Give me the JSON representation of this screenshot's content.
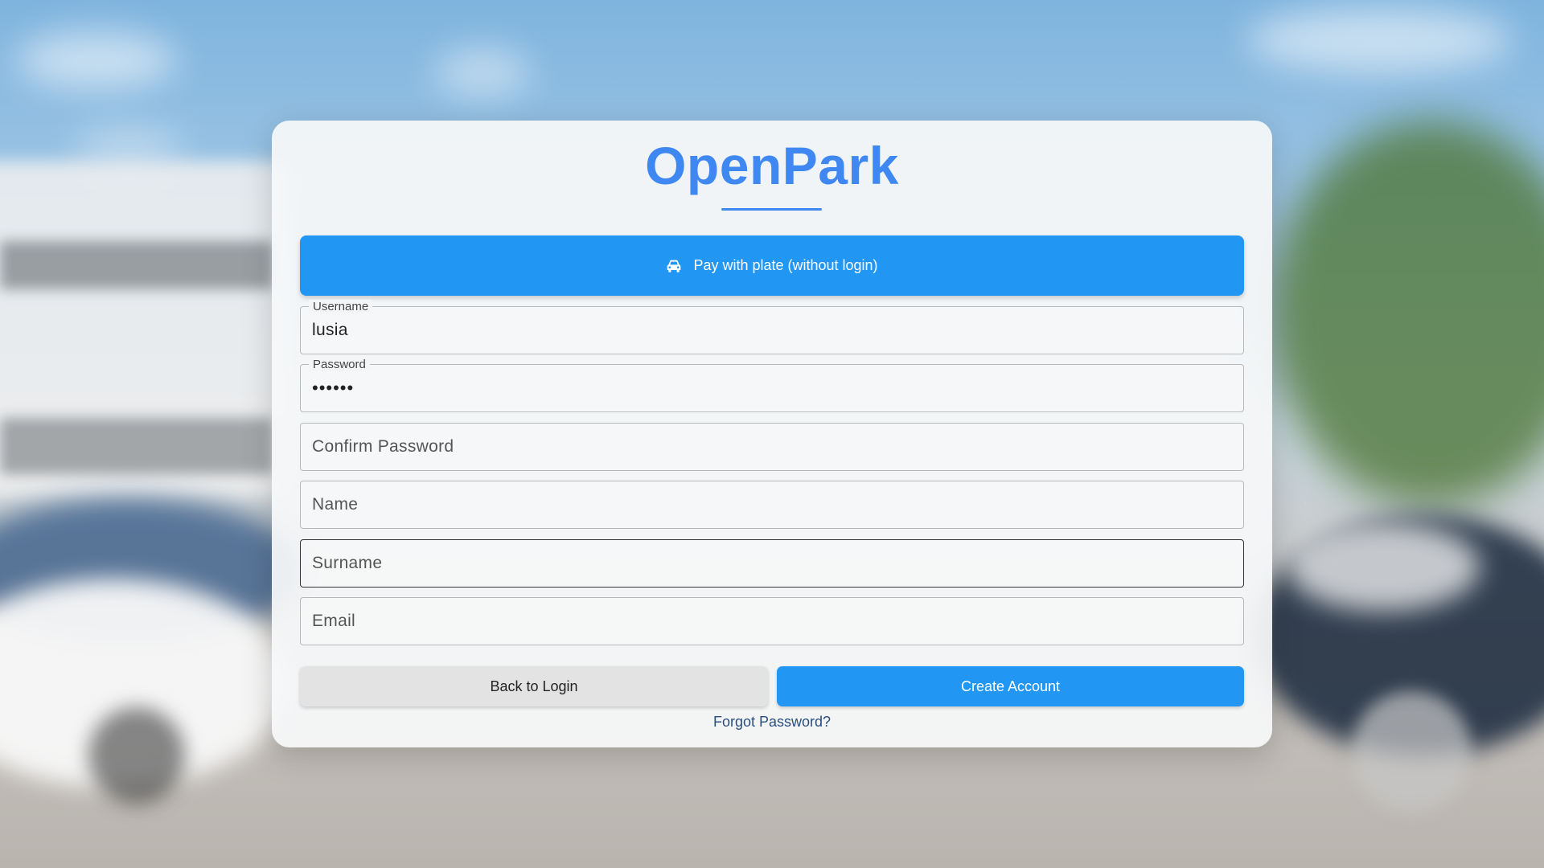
{
  "app": {
    "title": "OpenPark"
  },
  "plate_button": {
    "label": "Pay with plate (without login)",
    "icon": "car-icon"
  },
  "form": {
    "username": {
      "label": "Username",
      "value": "lusia"
    },
    "password": {
      "label": "Password",
      "value": "••••••"
    },
    "confirm_password": {
      "placeholder": "Confirm Password",
      "value": ""
    },
    "name": {
      "placeholder": "Name",
      "value": ""
    },
    "surname": {
      "placeholder": "Surname",
      "value": ""
    },
    "email": {
      "placeholder": "Email",
      "value": ""
    }
  },
  "actions": {
    "back_label": "Back to Login",
    "create_label": "Create Account",
    "forgot_label": "Forgot Password?"
  },
  "colors": {
    "brand": "#3f88f2",
    "primary_button": "#2196f3",
    "secondary_button": "#e3e3e3",
    "link": "#2b4f80"
  }
}
